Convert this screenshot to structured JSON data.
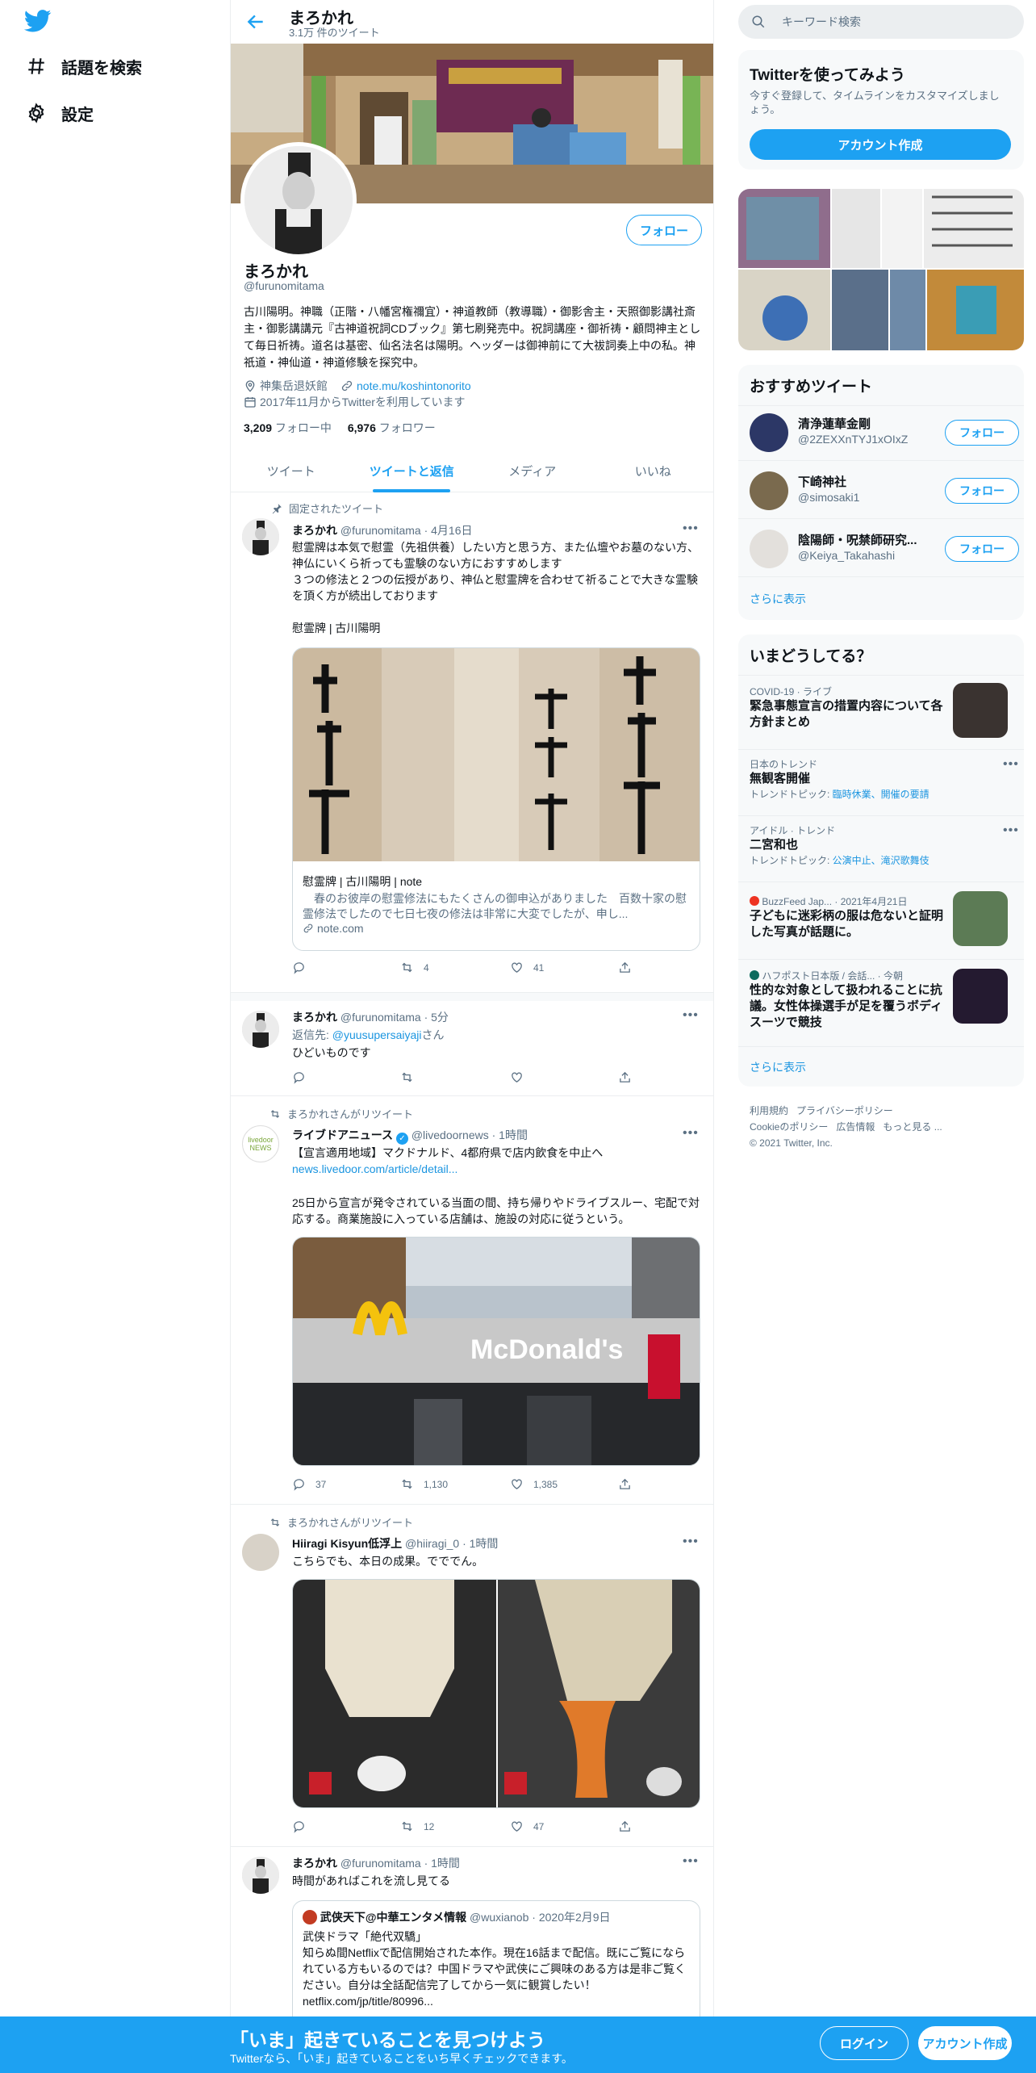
{
  "nav": {
    "explore": "話題を検索",
    "settings": "設定"
  },
  "header": {
    "name": "まろかれ",
    "tweet_count": "3.1万 件のツイート"
  },
  "profile": {
    "follow_label": "フォロー",
    "name": "まろかれ",
    "handle": "@furunomitama",
    "bio": "古川陽明。神職（正階・八幡宮権禰宜）・神道教師（教導職）・御影舎主・天照御影講社斎主・御影講講元『古神道祝詞CDブック』第七刷発売中。祝詞講座・御祈祷・顧問神主として毎日祈祷。道名は基密、仙名法名は陽明。ヘッダーは御神前にて大祓詞奏上中の私。神祇道・神仙道・神道修験を探究中。",
    "location": "神集岳退妖館",
    "link": "note.mu/koshintonorito",
    "joined": "2017年11月からTwitterを利用しています",
    "following_count": "3,209",
    "following_label": " フォロー中",
    "followers_count": "6,976",
    "followers_label": " フォロワー"
  },
  "tabs": [
    "ツイート",
    "ツイートと返信",
    "メディア",
    "いいね"
  ],
  "tweets": [
    {
      "context": "固定されたツイート",
      "name": "まろかれ",
      "handle": "@furunomitama",
      "time": "· 4月16日",
      "text": "慰霊牌は本気で慰霊（先祖供養）したい方と思う方、また仏壇やお墓のない方、神仏にいくら祈っても霊験のない方におすすめします\n３つの修法と２つの伝授があり、神仏と慰霊牌を合わせて祈ることで大きな霊験を頂く方が続出しております\n\n慰霊牌 | 古川陽明",
      "card_title": "慰霊牌 | 古川陽明 | note",
      "card_desc": "　春のお彼岸の慰霊修法にもたくさんの御申込がありました　百数十家の慰霊修法でしたので七日七夜の修法は非常に大変でしたが、申し...",
      "card_domain": "note.com",
      "replies": "",
      "retweets": "4",
      "likes": "41"
    },
    {
      "name": "まろかれ",
      "handle": "@furunomitama",
      "time": "· 5分",
      "reply_prefix": "返信先: ",
      "reply_to": "@yuusupersaiyaji",
      "reply_suffix": "さん",
      "text": "ひどいものです"
    },
    {
      "context": "まろかれさんがリツイート",
      "name": "ライブドアニュース",
      "handle": "@livedoornews",
      "time": "· 1時間",
      "avatar_text": "livedoor\nNEWS",
      "text": "【宣言適用地域】マクドナルド、4都府県で店内飲食を中止へ",
      "link": "news.livedoor.com/article/detail...",
      "text2": "25日から宣言が発令されている当面の間、持ち帰りやドライブスルー、宅配で対応する。商業施設に入っている店舗は、施設の対応に従うという。",
      "sign_text": "McDonald's",
      "replies": "37",
      "retweets": "1,130",
      "likes": "1,385"
    },
    {
      "context": "まろかれさんがリツイート",
      "name": "Hiiragi Kisyun低浮上",
      "handle": "@hiiragi_0",
      "time": "· 1時間",
      "text": "こちらでも、本日の成果。でででん。",
      "replies": "",
      "retweets": "12",
      "likes": "47"
    },
    {
      "name": "まろかれ",
      "handle": "@furunomitama",
      "time": "· 1時間",
      "text": "時間があればこれを流し見てる",
      "quote_name": "武侠天下@中華エンタメ情報",
      "quote_handle": "@wuxianob",
      "quote_time": "· 2020年2月9日",
      "quote_text": "武侠ドラマ「絶代双驕」\n知らぬ間Netflixで配信開始された本作。現在16話まで配信。既にご覧になられている方もいるのでは？中国ドラマや武侠にご興味のある方は是非ご覧ください。自分は全話配信完了してから一気に観賞したい！\nnetflix.com/jp/title/80996..."
    }
  ],
  "right": {
    "search_placeholder": "キーワード検索",
    "promo_title": "Twitterを使ってみよう",
    "promo_sub": "今すぐ登録して、タイムラインをカスタマイズしましょう。",
    "promo_button": "アカウント作成",
    "suggest_title": "おすすめツイート",
    "follow_label": "フォロー",
    "suggestions": [
      {
        "name": "清浄蓮華金剛",
        "handle": "@2ZEXXnTYJ1xOIxZ"
      },
      {
        "name": "下崎神社",
        "handle": "@simosaki1"
      },
      {
        "name": "陰陽師・呪禁師研究...",
        "handle": "@Keiya_Takahashi"
      }
    ],
    "show_more": "さらに表示",
    "trends_title": "いまどうしてる？",
    "trends": [
      {
        "category": "COVID-19 · ライブ",
        "title": "緊急事態宣言の措置内容について各方針まとめ"
      },
      {
        "category": "日本のトレンド",
        "title": "無観客開催",
        "topic_label": "トレンドトピック: ",
        "topic": "臨時休業、開催の要請"
      },
      {
        "category": "アイドル · トレンド",
        "title": "二宮和也",
        "topic_label": "トレンドトピック: ",
        "topic": "公演中止、滝沢歌舞伎"
      },
      {
        "category": "BuzzFeed Jap... · 2021年4月21日",
        "title": "子どもに迷彩柄の服は危ないと証明した写真が話題に。"
      },
      {
        "category": "ハフポスト日本版 / 会話... · 今朝",
        "title": "性的な対象として扱われることに抗議。女性体操選手が足を覆うボディスーツで競技"
      }
    ],
    "trends_more": "さらに表示",
    "footer": [
      "利用規約",
      "プライバシーポリシー",
      "Cookieのポリシー",
      "広告情報",
      "もっと見る ...",
      "© 2021 Twitter, Inc."
    ]
  },
  "bottom": {
    "title": "「いま」起きていることを見つけよう",
    "sub": "Twitterなら、「いま」起きていることをいち早くチェックできます。",
    "login": "ログイン",
    "signup": "アカウント作成"
  },
  "colors": {
    "accent": "#1da1f2",
    "link": "#1b95e0",
    "muted": "#5b7083"
  }
}
